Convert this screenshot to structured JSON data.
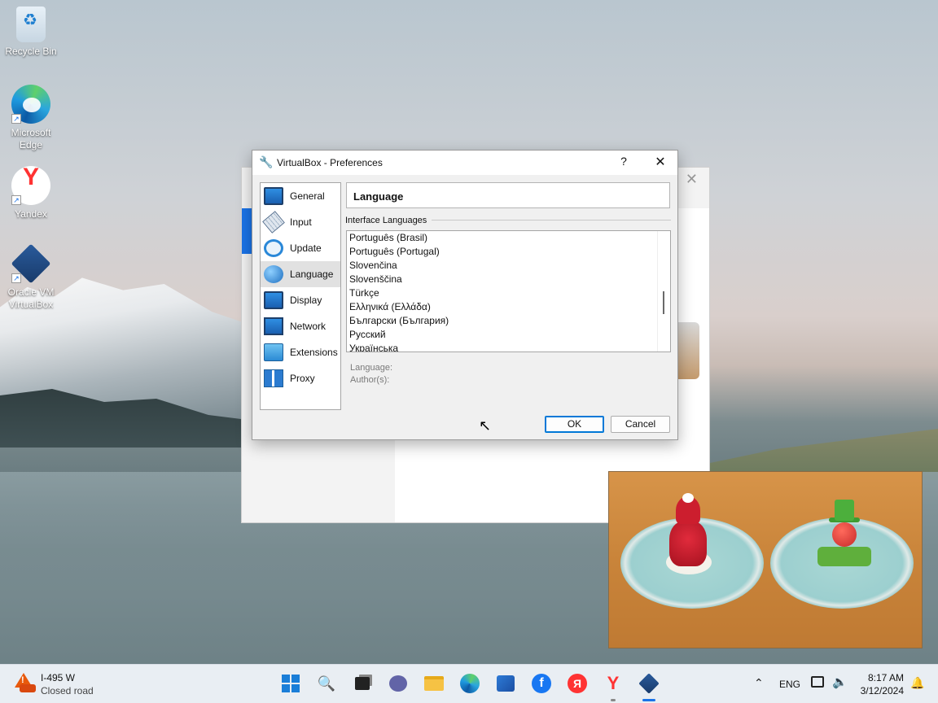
{
  "desktop": {
    "icons": [
      {
        "label": "Recycle Bin",
        "icon": "recycle-bin-icon"
      },
      {
        "label": "Microsoft Edge",
        "icon": "edge-icon"
      },
      {
        "label": "Yandex",
        "icon": "yandex-icon"
      },
      {
        "label": "Oracle VM VirtualBox",
        "icon": "virtualbox-icon"
      }
    ]
  },
  "dialog": {
    "title": "VirtualBox - Preferences",
    "help": "?",
    "close": "✕",
    "nav": [
      {
        "label": "General",
        "icon": "general-monitor-icon"
      },
      {
        "label": "Input",
        "icon": "keyboard-icon"
      },
      {
        "label": "Update",
        "icon": "update-icon"
      },
      {
        "label": "Language",
        "icon": "globe-icon",
        "active": true
      },
      {
        "label": "Display",
        "icon": "display-icon"
      },
      {
        "label": "Network",
        "icon": "network-icon"
      },
      {
        "label": "Extensions",
        "icon": "extensions-icon"
      },
      {
        "label": "Proxy",
        "icon": "proxy-icon"
      }
    ],
    "page_header": "Language",
    "section_label": "Interface Languages",
    "languages": [
      "Português (Brasil)",
      "Português (Portugal)",
      "Slovenčina",
      "Slovenščina",
      "Türkçe",
      "Ελληνικά (Ελλάδα)",
      "Български (България)",
      "Русский",
      "Українська"
    ],
    "info_language_label": "Language:",
    "info_author_label": "Author(s):",
    "ok_label": "OK",
    "cancel_label": "Cancel"
  },
  "taskbar": {
    "weather_title": "I-495 W",
    "weather_sub": "Closed road",
    "search_glyph": "🔍",
    "facebook_glyph": "f",
    "yabrowser_glyph": "Я",
    "yandex_glyph": "Y",
    "tray_chevron": "⌃",
    "language": "ENG",
    "time": "8:17 AM",
    "date": "3/12/2024"
  },
  "colors": {
    "accent": "#0078d7",
    "taskbar_active": "#1a73e8"
  }
}
